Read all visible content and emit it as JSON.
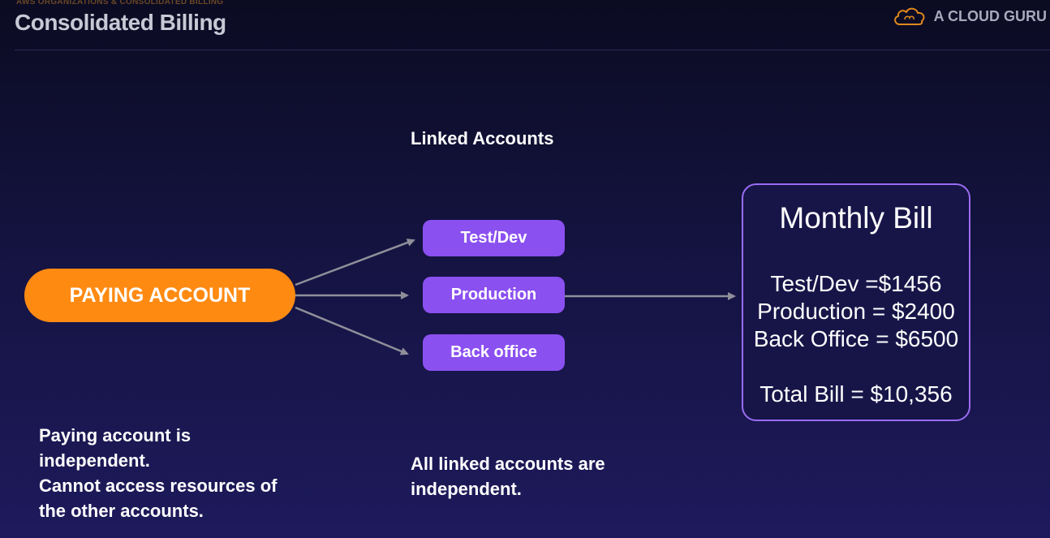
{
  "header": {
    "kicker": "AWS ORGANIZATIONS & CONSOLIDATED BILLING",
    "title": "Consolidated Billing",
    "brand": {
      "icon": "cloud-icon",
      "name": "A CLOUD GURU"
    }
  },
  "diagram": {
    "section_label": "Linked Accounts",
    "paying_account": "PAYING ACCOUNT",
    "linked_accounts": [
      "Test/Dev",
      "Production",
      "Back office"
    ],
    "monthly_bill": {
      "title": "Monthly Bill",
      "lines": [
        "Test/Dev =$1456",
        "Production = $2400",
        "Back Office = $6500"
      ],
      "total": "Total Bill = $10,356"
    }
  },
  "notes": {
    "paying": [
      "Paying account is",
      "independent.",
      "Cannot access resources of",
      "the other accounts."
    ],
    "linked": [
      "All linked accounts are",
      "independent."
    ]
  },
  "colors": {
    "paying_account": "#ff8a12",
    "linked_account": "#8b50f0",
    "bill_border": "#9a6cf0",
    "arrow": "#8f8f9a"
  }
}
